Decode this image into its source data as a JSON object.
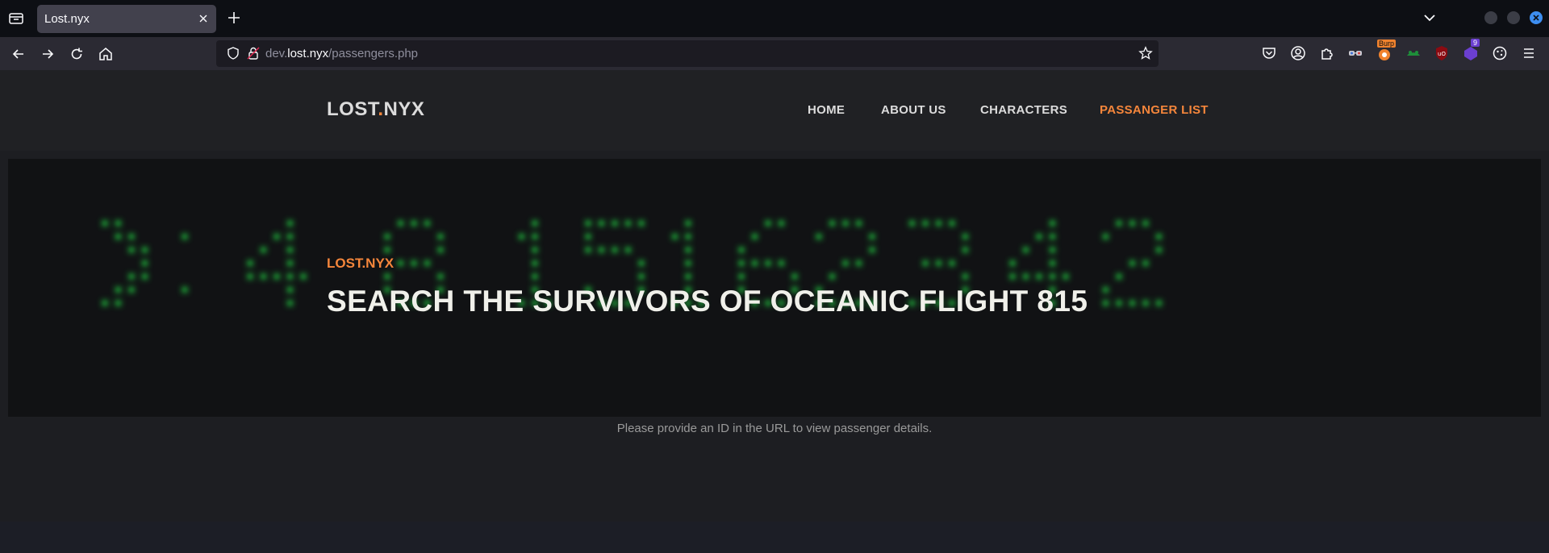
{
  "browser": {
    "tab": {
      "title": "Lost.nyx"
    },
    "url": {
      "prefix": "dev.",
      "domain": "lost.nyx",
      "path": "/passengers.php"
    },
    "extensions": [
      "pocket-icon",
      "account-icon",
      "extensions-icon",
      "glasses-icon",
      "burp-icon",
      "frog-icon",
      "ublock-icon",
      "dark-reader-icon",
      "cookie-icon",
      "hamburger-menu-icon"
    ],
    "badges": {
      "burp": "Burp",
      "dark_reader": "9"
    }
  },
  "site": {
    "logo": {
      "left": "LOST",
      "dot": ".",
      "right": "NYX"
    },
    "nav": [
      {
        "label": "HOME"
      },
      {
        "label": "ABOUT US"
      },
      {
        "label": "CHARACTERS"
      },
      {
        "label": "PASSANGER LIST"
      }
    ],
    "hero": {
      "kicker": "LOST.NYX",
      "title": "SEARCH THE SURVIVORS OF OCEANIC FLIGHT 815",
      "numbers": ">: 4 8 15 16 23 42"
    },
    "notice": "Please provide an ID in the URL to view passenger details."
  },
  "colors": {
    "accent": "#f5863b",
    "terminal_green": "#1fae3a"
  }
}
